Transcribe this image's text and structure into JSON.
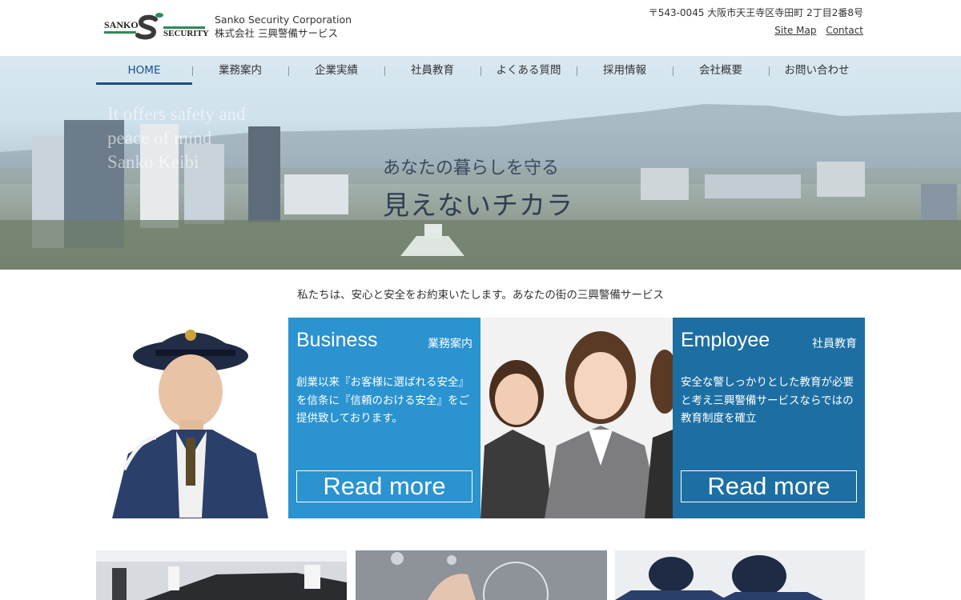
{
  "header": {
    "logo_left": "SANKO",
    "logo_right": "SECURITY",
    "company_en": "Sanko Security Corporation",
    "company_jp": "株式会社 三興警備サービス",
    "address": "〒543-0045 大阪市天王寺区寺田町 2丁目2番8号",
    "links": [
      "Site Map",
      "Contact"
    ]
  },
  "nav": {
    "items": [
      "HOME",
      "業務案内",
      "企業実績",
      "社員教育",
      "よくある質問",
      "採用情報",
      "会社概要",
      "お問い合わせ"
    ],
    "active_index": 0
  },
  "hero": {
    "english_lines": [
      "It offers safety and",
      "peace of mind",
      "Sanko Keibi"
    ],
    "catch_line1": "あなたの暮らしを守る",
    "catch_line2": "見えないチカラ"
  },
  "tagline": "私たちは、安心と安全をお約束いたします。あなたの街の三興警備サービス",
  "panels": [
    {
      "title": "Business",
      "subtitle": "業務案内",
      "text": "創業以来『お客様に選ばれる安全』を信条に『信頼のおける安全』をご提供致しております。",
      "button": "Read more",
      "color": "#2a93d0"
    },
    {
      "title": "Employee",
      "subtitle": "社員教育",
      "text": "安全な警しっかりとした教育が必要と考え三興警備サービスならではの教育制度を確立",
      "button": "Read more",
      "color": "#1d6fa3"
    }
  ],
  "colors": {
    "nav_active": "#1a4f8a",
    "logo_green": "#2e8b57"
  }
}
